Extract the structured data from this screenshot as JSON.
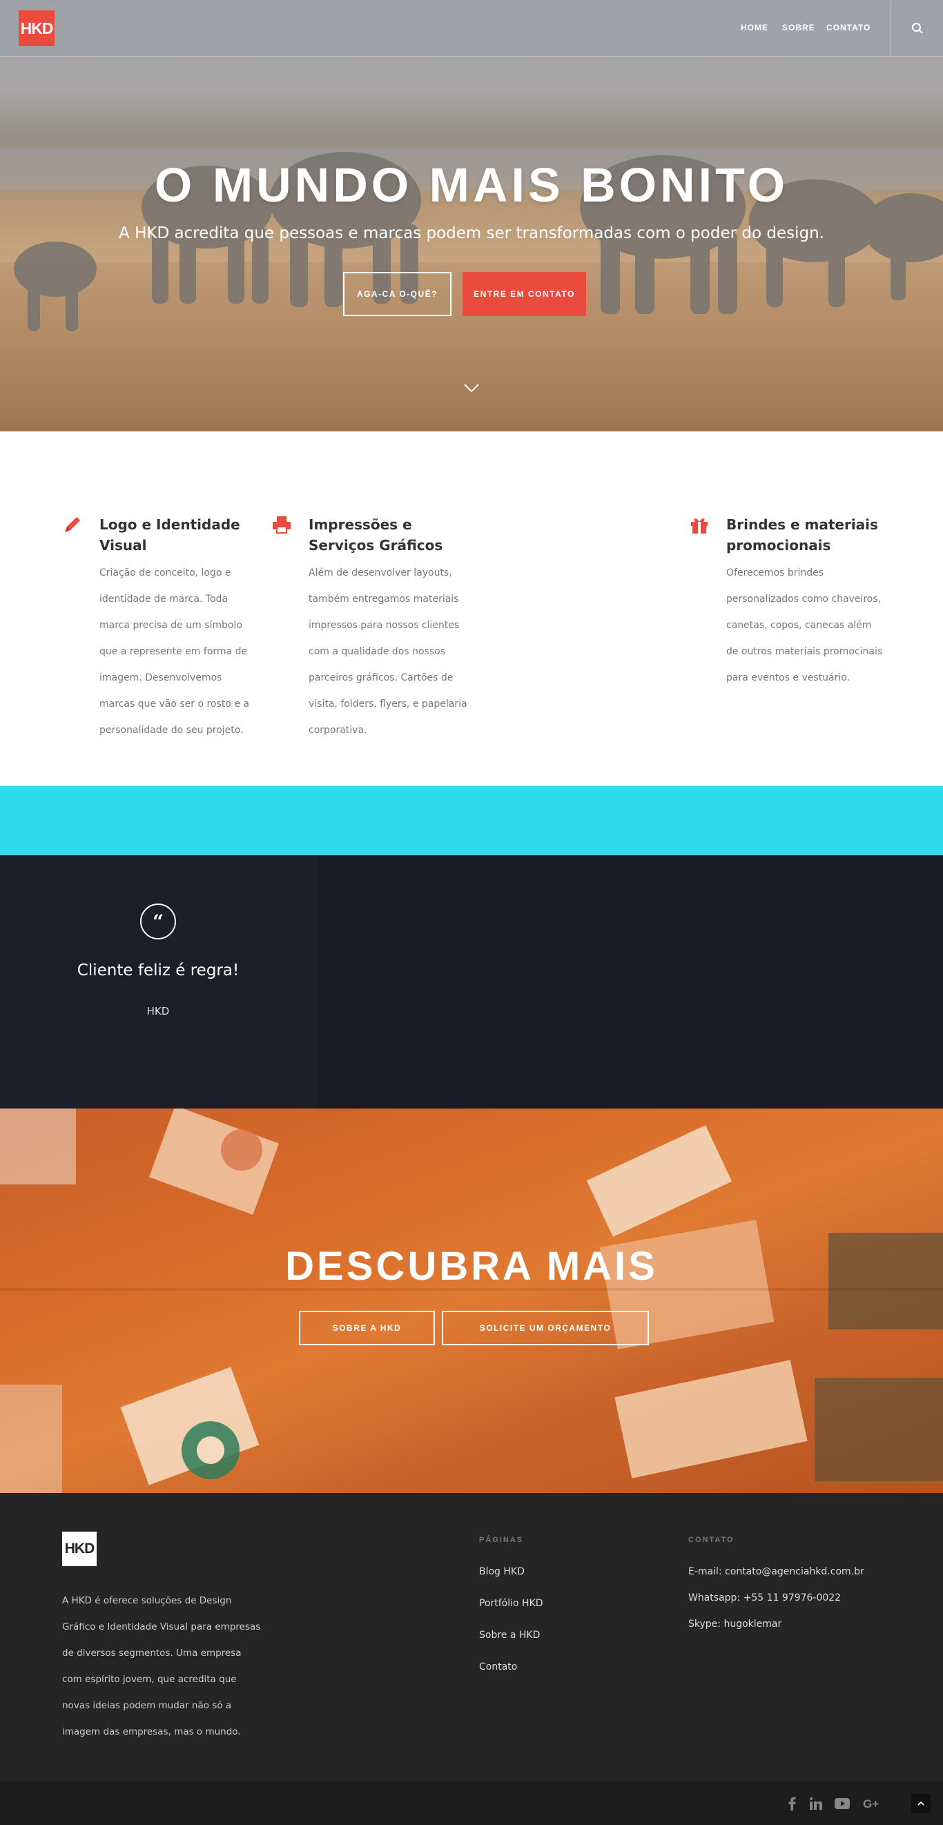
{
  "header": {
    "logo": "HKD",
    "nav": [
      "HOME",
      "SOBRE",
      "CONTATO"
    ],
    "active": "HOME"
  },
  "hero": {
    "title": "O MUNDO MAIS BONITO",
    "subtitle": "A HKD acredita que pessoas e marcas podem ser transformadas com o poder do design.",
    "btn_secondary": "AGA-CA O-QUÊ?",
    "btn_primary": "ENTRE EM CONTATO"
  },
  "services": [
    {
      "icon": "pencil-icon",
      "title": "Logo e Identidade Visual",
      "text": "Criação de conceito, logo e identidade de marca. Toda marca precisa de um símbolo que a represente em forma de imagem. Desenvolvemos marcas que vão ser o rosto e a personalidade do seu projeto."
    },
    {
      "icon": "printer-icon",
      "title": "Impressões e Serviços Gráficos",
      "text": "Além de desenvolver layouts, também entregamos materiais impressos para nossos clientes com a qualidade dos nossos parceiros gráficos. Cartões de visita, folders, flyers, e papelaria corporativa."
    },
    {
      "icon": "gift-icon",
      "title": "Brindes e materiais promocionais",
      "text": "Oferecemos brindes personalizados como chaveiros, canetas, copos, canecas além de outros materiais promocinais para eventos e vestuário."
    }
  ],
  "testimonial": {
    "quote_mark": "“",
    "text": "Cliente feliz é regra!",
    "author": "HKD"
  },
  "discover": {
    "title": "DESCUBRA MAIS",
    "btn_about": "SOBRE A HKD",
    "btn_quote": "SOLICITE UM ORÇAMENTO"
  },
  "footer": {
    "logo": "HKD",
    "about": "A HKD é oferece soluções de Design Gráfico e Identidade Visual para empresas de diversos segmentos. Uma empresa com espírito jovem, que acredita que novas ideias podem mudar não só a imagem das empresas, mas o mundo.",
    "pages_heading": "PÁGINAS",
    "pages": [
      "Blog HKD",
      "Portfólio HKD",
      "Sobre a HKD",
      "Contato"
    ],
    "contact_heading": "CONTATO",
    "contact": [
      "E-mail: contato@agenciahkd.com.br",
      "Whatsapp: +55 11 97976-0022",
      "Skype: hugoklemar"
    ]
  },
  "colors": {
    "accent": "#e94b3c",
    "cyan": "#2fdcec",
    "dark": "#1b1e27",
    "footer": "#252525"
  }
}
